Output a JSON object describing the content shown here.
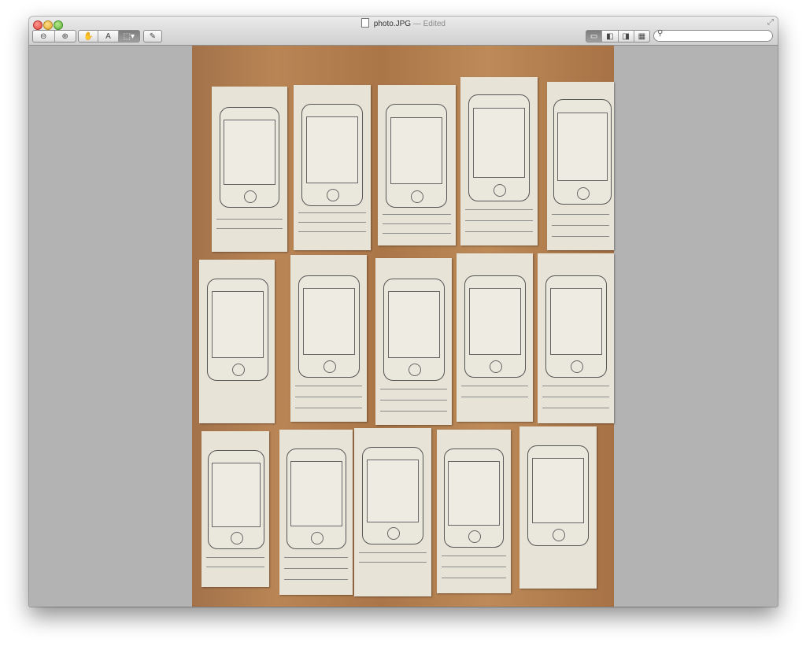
{
  "window": {
    "filename": "photo.JPG",
    "status": "— Edited"
  },
  "toolbar": {
    "zoom_out_icon": "zoom-out-icon",
    "zoom_in_icon": "zoom-in-icon",
    "hand_icon": "hand-tool-icon",
    "text_select_icon": "text-select-icon",
    "select_icon": "rect-select-icon",
    "markup_icon": "pencil-icon"
  },
  "view_modes": [
    "content-only",
    "thumbnails",
    "table-of-contents",
    "contact-sheet"
  ],
  "search": {
    "placeholder": "",
    "icon": "search-icon"
  },
  "colors": {
    "close": "#e0443e",
    "minimize": "#e0a62b",
    "zoom": "#5fb33c",
    "canvas_bg": "#b3b3b3",
    "paper": "#e7e3d6",
    "wood": "#b07c4e"
  }
}
